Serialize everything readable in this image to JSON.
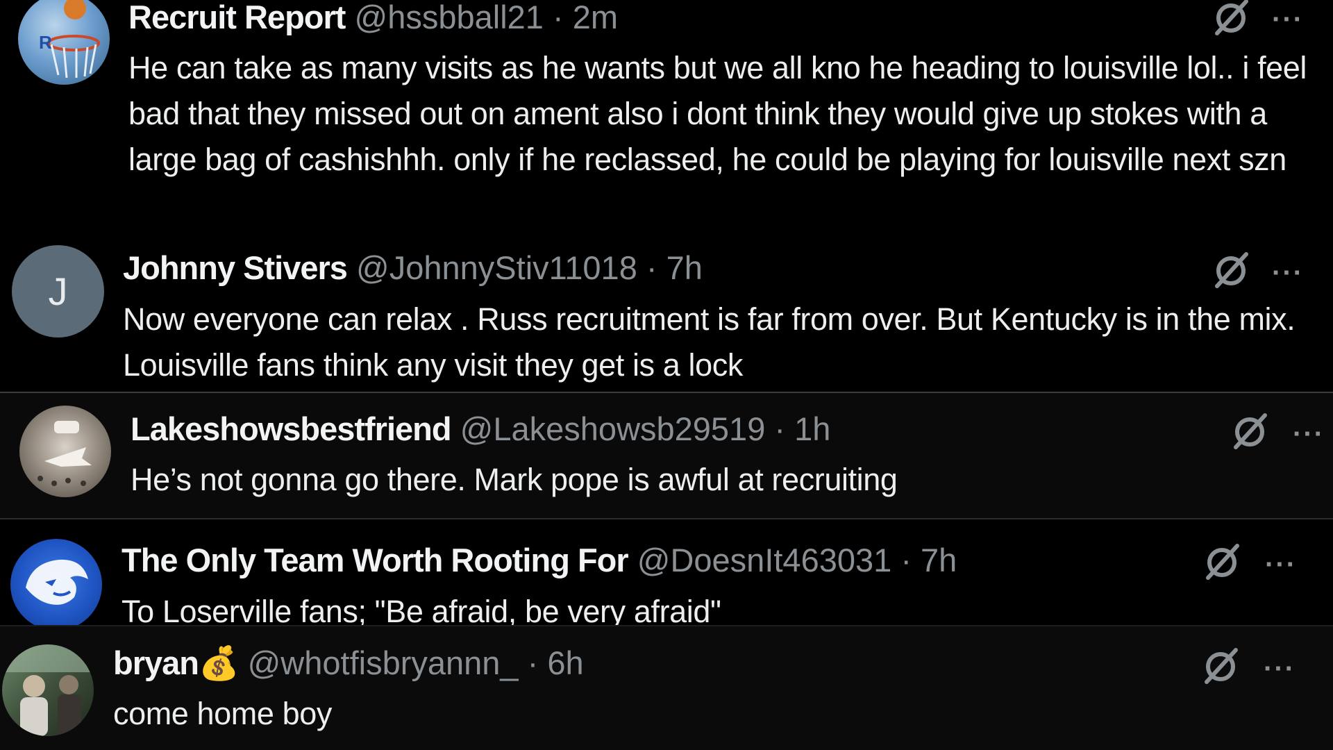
{
  "replies": [
    {
      "display_name": "Recruit Report",
      "handle_time": "@hssbball21 · 2m",
      "text": "He can take as many visits as he wants but we all kno he heading to louisville lol.. i feel bad that they missed out on ament also i dont think they would give up stokes with a large bag of cashishhh. only if he reclassed, he could be playing for louisville next szn"
    },
    {
      "display_name": "Johnny Stivers",
      "handle_time": "@JohnnyStiv11018 · 7h",
      "avatar_letter": "J",
      "text": "Now everyone can relax . Russ recruitment is far from over. But Kentucky is in the mix. Louisville fans think any visit they get is a lock"
    },
    {
      "display_name": "Lakeshowsbestfriend",
      "handle_time": "@Lakeshowsb29519 · 1h",
      "text": "He’s not gonna go there. Mark pope is awful at recruiting"
    },
    {
      "display_name": "The Only Team Worth Rooting For",
      "handle_time": "@DoesnIt463031 · 7h",
      "text": "To Loserville fans; \"Be afraid, be very afraid\""
    },
    {
      "display_name": "bryan💰",
      "handle_time": "@whotfisbryannn_ · 6h",
      "text": "come home boy"
    }
  ],
  "more_label": "···",
  "icons": {
    "grok": "grok-slash-icon",
    "more": "more-dots-icon"
  },
  "colors": {
    "background": "#000000",
    "text": "#e7e9ea",
    "secondary": "#8b9095",
    "avatar_gray": "#5c6b78"
  }
}
